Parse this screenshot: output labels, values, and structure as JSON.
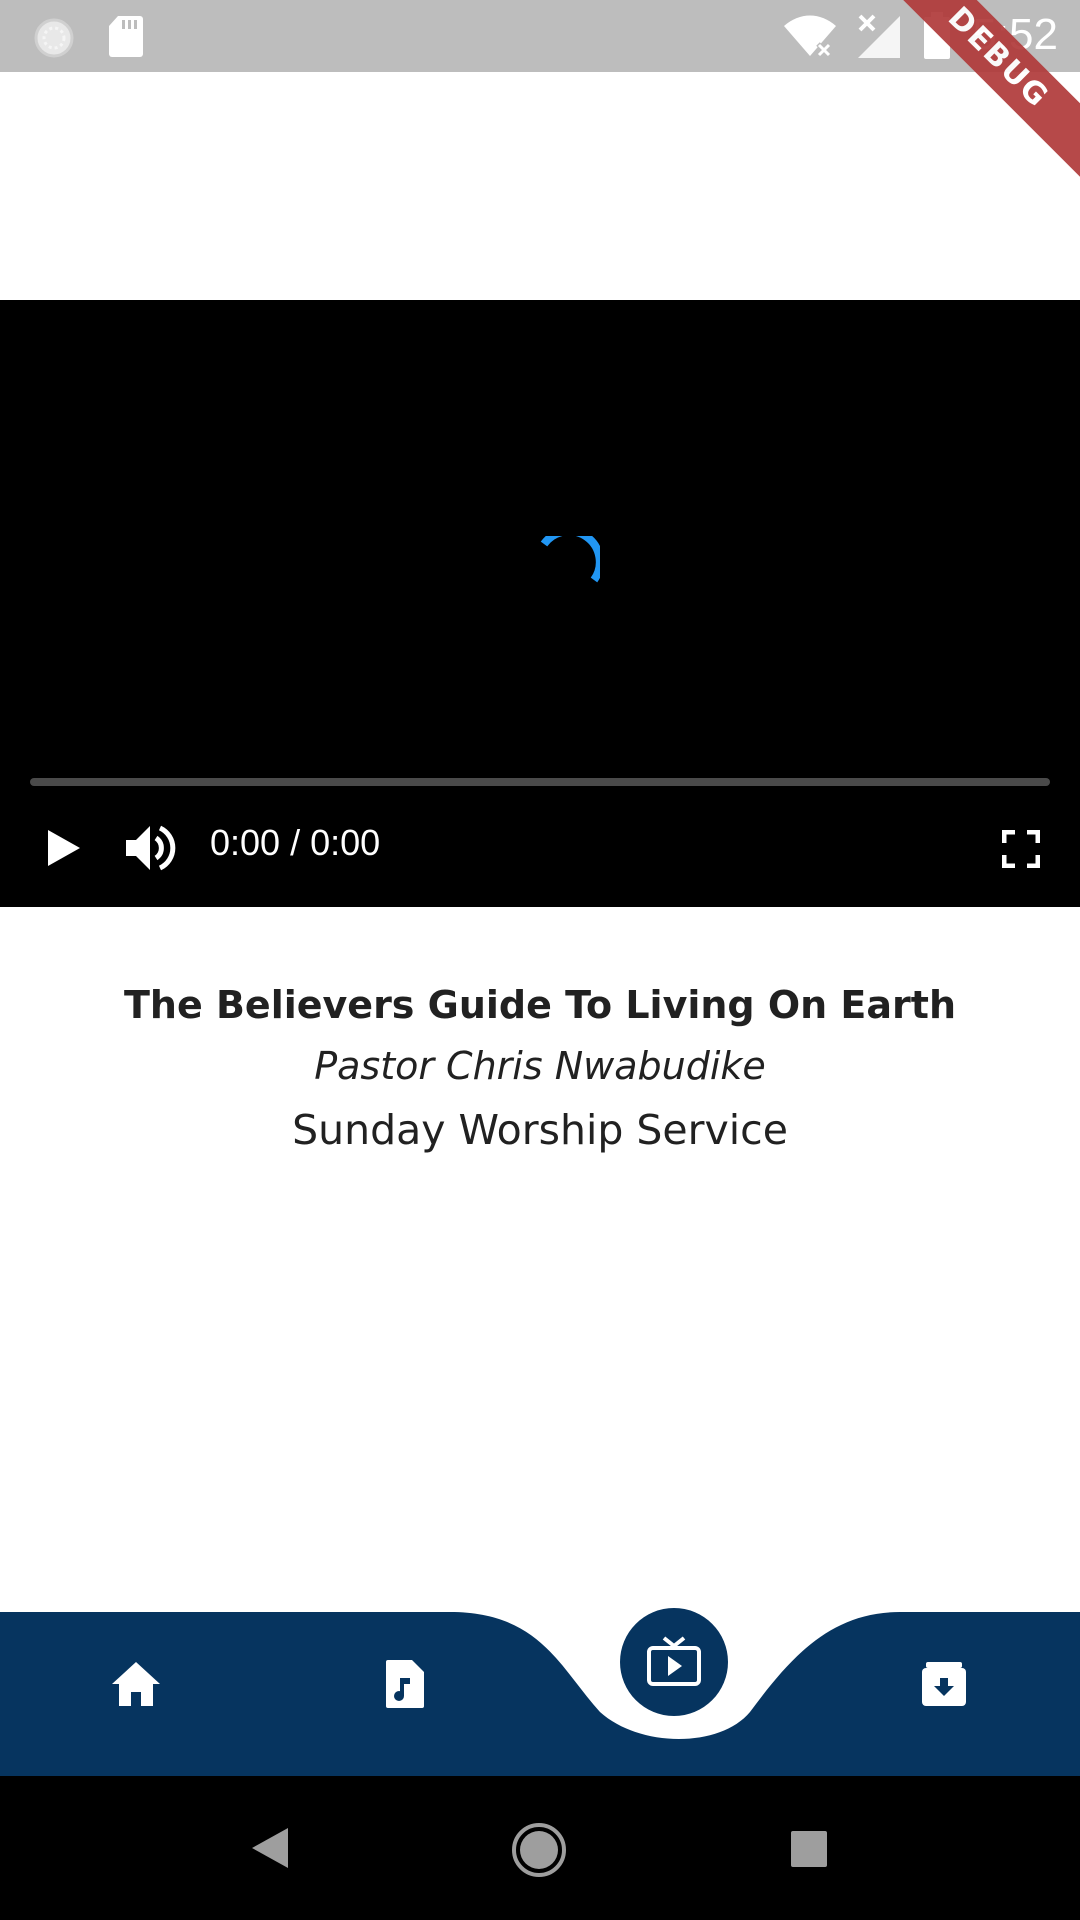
{
  "status_bar": {
    "time": "5:52",
    "debug_banner": "DEBUG",
    "icons": [
      "sync-icon",
      "sd-card-icon",
      "wifi-off-icon",
      "signal-off-icon",
      "battery-icon"
    ]
  },
  "video_player": {
    "loading": true,
    "progress": 0,
    "time_display": "0:00 / 0:00",
    "controls": [
      "play-icon",
      "volume-icon",
      "fullscreen-icon"
    ],
    "spinner_color": "#2196f3"
  },
  "sermon": {
    "title": "The Believers Guide To Living On Earth",
    "preacher": "Pastor Chris Nwabudike",
    "service": "Sunday Worship Service"
  },
  "bottom_nav": {
    "background": "#06345f",
    "items": [
      {
        "icon": "home-icon"
      },
      {
        "icon": "audio-file-icon"
      },
      {
        "icon": "live-tv-icon",
        "active": true
      },
      {
        "icon": "archive-download-icon"
      }
    ]
  },
  "system_nav": [
    "back-icon",
    "home-circle-icon",
    "recents-icon"
  ]
}
